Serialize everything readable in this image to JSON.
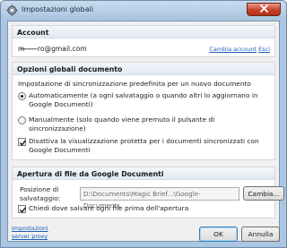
{
  "window": {
    "title": "Impostazioni globali"
  },
  "account": {
    "section_title": "Account",
    "email": "m̶ ̶ ̶ ̶ ̶ ̶ ̶ro@gmail.com",
    "change_account_link": "Cambia account",
    "logout_link": "Esci"
  },
  "document_options": {
    "section_title": "Opzioni globali documento",
    "sync_setting_label": "Impostazione di sincronizzazione predefinita per un nuovo documento",
    "radio_auto_label": "Automaticamente (a ogni salvataggio o quando altri lo aggiornano in Google Documenti)",
    "radio_auto_checked": true,
    "radio_manual_label": "Manualmente (solo quando viene premuto il pulsante di sincronizzazione)",
    "radio_manual_checked": false,
    "protected_view_label": "Disattiva la visualizzazione protetta per i documenti sincronizzati con Google Documenti",
    "protected_view_checked": true
  },
  "open_files": {
    "section_title": "Apertura di file da Google Documenti",
    "save_position_label": "Posizione di salvataggio:",
    "save_path_value": "D:\\Documents\\Magic Brief...\\Google-Documents",
    "change_button": "Cambia...",
    "ask_location_label": "Chiedi dove salvare ogni file prima dell'apertura",
    "ask_location_checked": true
  },
  "footer": {
    "proxy_link": "Impostazioni server proxy",
    "ok_button": "OK",
    "cancel_button": "Annulla"
  },
  "colors": {
    "link": "#1b5fbf",
    "close_button": "#c8402a",
    "window_frame": "#a9c6e2"
  },
  "icons": [
    "gear-icon",
    "close-icon",
    "check-icon"
  ]
}
